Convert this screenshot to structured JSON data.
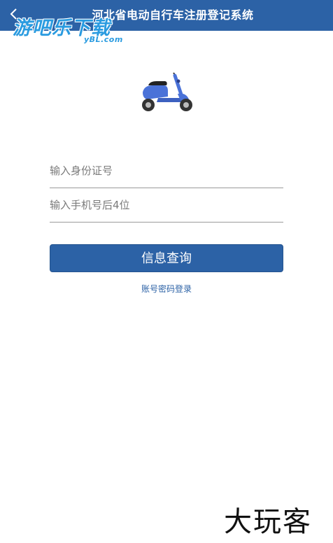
{
  "header": {
    "title": "河北省电动自行车注册登记系统",
    "back_icon": "chevron-left-icon"
  },
  "watermark_top": {
    "main": "游吧乐下载",
    "sub": "yBL.com"
  },
  "hero": {
    "icon": "scooter-icon",
    "colors": {
      "body": "#4a72d8",
      "wheel": "#333333",
      "seat": "#222222"
    }
  },
  "form": {
    "id_card_placeholder": "输入身份证号",
    "id_card_value": "",
    "phone_placeholder": "输入手机号后4位",
    "phone_value": ""
  },
  "actions": {
    "query_label": "信息查询",
    "login_link": "账号密码登录"
  },
  "watermark_bottom": {
    "text": "大玩客"
  },
  "colors": {
    "primary": "#2c62a6",
    "background": "#ffffff",
    "underline": "#9a9a9a"
  }
}
